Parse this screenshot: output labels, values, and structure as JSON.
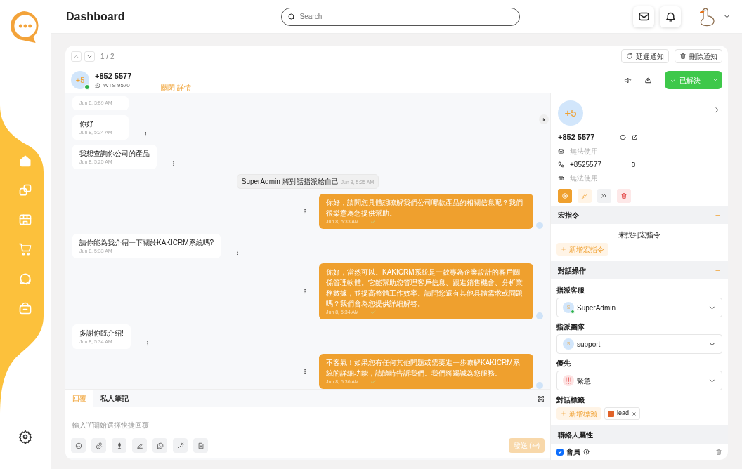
{
  "app": {
    "title": "Dashboard"
  },
  "search": {
    "placeholder": "Search"
  },
  "toolbar": {
    "pager": "1 / 2",
    "buttons": [
      {
        "label": "延遲通知",
        "kind": "snooze"
      },
      {
        "label": "刪除通知",
        "kind": "delete"
      }
    ]
  },
  "conversation": {
    "avatar": "+5",
    "name": "+852 5577",
    "channel": "WTS 9570",
    "toggle": "關閉 詳情",
    "resolve": "已解決"
  },
  "messages": [
    {
      "kind": "incoming",
      "time": "Jun 8, 3:59 AM"
    },
    {
      "kind": "incoming",
      "text": "你好",
      "time": "Jun 8, 5:24 AM"
    },
    {
      "kind": "incoming",
      "text": "我想查詢你公司的產品",
      "time": "Jun 8, 5:25 AM"
    },
    {
      "kind": "system",
      "text": "SuperAdmin 將對話指派給自己",
      "time": "Jun 8, 5:25 AM"
    },
    {
      "kind": "outgoing",
      "text": "你好，請問您具體想瞭解我們公司哪款產品的相關信息呢？我們很樂意為您提供幫助。",
      "time": "Jun 8, 5:33 AM"
    },
    {
      "kind": "incoming",
      "text": "請你能為我介紹一下關於KAKICRM系統嗎?",
      "time": "Jun 8, 5:33 AM"
    },
    {
      "kind": "outgoing",
      "text": "你好，當然可以。KAKICRM系統是一款專為企業設計的客戶關係管理軟體。它能幫助您管理客戶信息、跟進銷售機會、分析業務數據，並提高整體工作效率。請問您還有其他具體需求或問題嗎？我們會為您提供詳細解答。",
      "time": "Jun 8, 5:34 AM"
    },
    {
      "kind": "incoming",
      "text": "多謝你既介紹!",
      "time": "Jun 8, 5:34 AM"
    },
    {
      "kind": "outgoing",
      "text": "不客氣！如果您有任何其他問題或需要進一步瞭解KAKICRM系統的詳細功能，請隨時告訴我們。我們將竭誠為您服務。",
      "time": "Jun 8, 5:36 AM"
    }
  ],
  "composer": {
    "tabs": [
      {
        "label": "回覆",
        "selected": true
      },
      {
        "label": "私人筆記",
        "selected": false
      }
    ],
    "placeholder": "輸入“/”開始選擇快捷回覆",
    "send": "發送 (↩)",
    "send_disabled": true
  },
  "contact": {
    "avatar": "+5",
    "name": "+852 5577",
    "email": "無法使用",
    "phone": "+8525577",
    "company": "無法使用"
  },
  "macros": {
    "title": "宏指令",
    "empty": "未找到宏指令",
    "add": "新增宏指令"
  },
  "actions": {
    "title": "對話操作",
    "fields": [
      {
        "label": "指派客服",
        "kind": "person",
        "avatar": "S",
        "online": true,
        "value": "SuperAdmin"
      },
      {
        "label": "指派團隊",
        "kind": "person",
        "avatar": "S",
        "online": false,
        "value": "support"
      },
      {
        "label": "優先",
        "kind": "priority",
        "value": "緊急"
      }
    ],
    "tags_label": "對話標籤",
    "add_tag": "新增標籤",
    "tags": [
      {
        "label": "lead",
        "color": "#e0632a"
      }
    ]
  },
  "attributes": {
    "title": "聯絡人屬性",
    "items": [
      {
        "label": "會員",
        "checked": true
      }
    ]
  }
}
